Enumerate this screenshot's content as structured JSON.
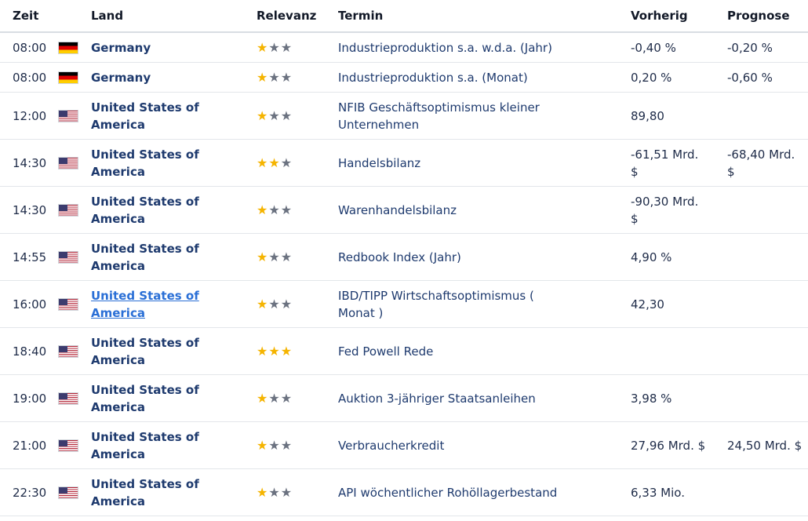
{
  "headers": {
    "time": "Zeit",
    "land": "Land",
    "relevance": "Relevanz",
    "event": "Termin",
    "previous": "Vorherig",
    "forecast": "Prognose"
  },
  "rows": [
    {
      "time": "08:00",
      "flag": "germany-flag-icon",
      "land": "Germany",
      "stars": 1,
      "event": "Industrieproduktion s.a. w.d.a. (Jahr)",
      "previous": "-0,40 %",
      "forecast": "-0,20 %"
    },
    {
      "time": "08:00",
      "flag": "germany-flag-icon",
      "land": "Germany",
      "stars": 1,
      "event": "Industrieproduktion s.a. (Monat)",
      "previous": "0,20 %",
      "forecast": "-0,60 %"
    },
    {
      "time": "12:00",
      "flag": "usa-flag-icon",
      "land": "United States of America",
      "stars": 1,
      "event": "NFIB Geschäftsoptimismus kleiner Unternehmen",
      "previous": "89,80",
      "forecast": ""
    },
    {
      "time": "14:30",
      "flag": "usa-flag-icon",
      "land": "United States of America",
      "stars": 2,
      "event": "Handelsbilanz",
      "previous": "-61,51 Mrd. $",
      "forecast": "-68,40 Mrd. $"
    },
    {
      "time": "14:30",
      "flag": "usa-flag-icon",
      "land": "United States of America",
      "stars": 1,
      "event": "Warenhandelsbilanz",
      "previous": "-90,30 Mrd. $",
      "forecast": ""
    },
    {
      "time": "14:55",
      "flag": "usa-flag-icon",
      "land": "United States of America",
      "stars": 1,
      "event": "Redbook Index (Jahr)",
      "previous": "4,90 %",
      "forecast": ""
    },
    {
      "time": "16:00",
      "flag": "usa-flag-icon",
      "land": "United States of America",
      "stars": 1,
      "event": "IBD/TIPP Wirtschaftsoptimismus ( Monat )",
      "previous": "42,30",
      "forecast": "",
      "hovered": true
    },
    {
      "time": "18:40",
      "flag": "usa-flag-icon",
      "land": "United States of America",
      "stars": 3,
      "event": "Fed Powell Rede",
      "previous": "",
      "forecast": ""
    },
    {
      "time": "19:00",
      "flag": "usa-flag-icon",
      "land": "United States of America",
      "stars": 1,
      "event": "Auktion 3-jähriger Staatsanleihen",
      "previous": "3,98 %",
      "forecast": ""
    },
    {
      "time": "21:00",
      "flag": "usa-flag-icon",
      "land": "United States of America",
      "stars": 1,
      "event": "Verbraucherkredit",
      "previous": "27,96 Mrd. $",
      "forecast": "24,50 Mrd. $"
    },
    {
      "time": "22:30",
      "flag": "usa-flag-icon",
      "land": "United States of America",
      "stars": 1,
      "event": "API wöchentlicher Rohöllagerbestand",
      "previous": "6,33 Mio.",
      "forecast": ""
    }
  ],
  "colors": {
    "star_on": "#f5b400",
    "star_off": "#6b7280",
    "link": "#2a6fd6"
  }
}
